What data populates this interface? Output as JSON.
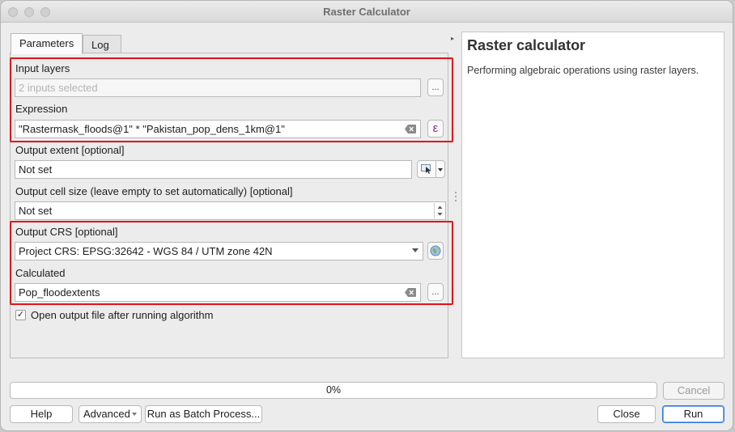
{
  "window": {
    "title": "Raster Calculator"
  },
  "tabs": [
    {
      "label": "Parameters",
      "active": true
    },
    {
      "label": "Log",
      "active": false
    }
  ],
  "params": {
    "input_layers_label": "Input layers",
    "input_layers_value": "2 inputs selected",
    "expression_label": "Expression",
    "expression_value": "\"Rastermask_floods@1\" * \"Pakistan_pop_dens_1km@1\"",
    "extent_label": "Output extent [optional]",
    "extent_value": "Not set",
    "cellsize_label": "Output cell size (leave empty to set automatically) [optional]",
    "cellsize_value": "Not set",
    "crs_label": "Output CRS [optional]",
    "crs_value": "Project CRS: EPSG:32642 - WGS 84 / UTM zone 42N",
    "calculated_label": "Calculated",
    "calculated_value": "Pop_floodextents",
    "open_output_label": "Open output file after running algorithm",
    "open_output_checked": true,
    "browse_glyph": "...",
    "epsilon_glyph": "ε"
  },
  "help_panel": {
    "title": "Raster calculator",
    "description": "Performing algebraic operations using raster layers."
  },
  "progress": {
    "value": 0,
    "label": "0%"
  },
  "buttons": {
    "cancel": "Cancel",
    "help": "Help",
    "advanced": "Advanced",
    "batch": "Run as Batch Process...",
    "close": "Close",
    "run": "Run"
  },
  "colors": {
    "highlight": "#e0141a",
    "accent": "#2f76d8"
  }
}
